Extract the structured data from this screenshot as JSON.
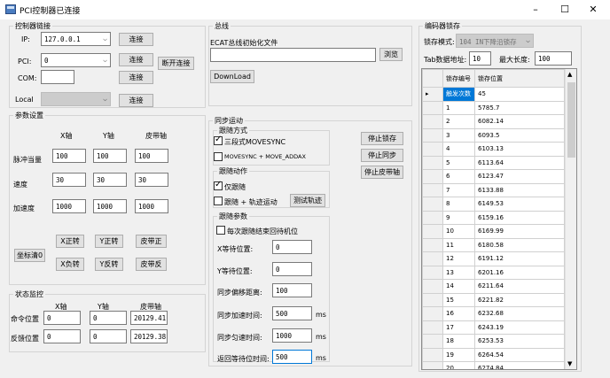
{
  "window": {
    "title": "PCI控制器已连接",
    "minimize": "–",
    "maximize": "☐",
    "close": "✕"
  },
  "controller": {
    "legend": "控制器链接",
    "ip_label": "IP:",
    "ip_value": "127.0.0.1",
    "pci_label": "PCI:",
    "pci_value": "0",
    "com_label": "COM:",
    "com_value": "",
    "local_label": "Local",
    "local_value": "",
    "connect_label": "连接",
    "disconnect_label": "断开连接"
  },
  "params": {
    "legend": "参数设置",
    "col_x": "X轴",
    "col_y": "Y轴",
    "col_belt": "皮带轴",
    "rows": [
      {
        "label": "脉冲当量",
        "x": "100",
        "y": "100",
        "belt": "100"
      },
      {
        "label": "速度",
        "x": "30",
        "y": "30",
        "belt": "30"
      },
      {
        "label": "加速度",
        "x": "1000",
        "y": "1000",
        "belt": "1000"
      }
    ],
    "zero_label": "坐标清0",
    "x_fwd": "X正转",
    "y_fwd": "Y正转",
    "belt_fwd": "皮带正",
    "x_rev": "X负转",
    "y_rev": "Y反转",
    "belt_rev": "皮带反"
  },
  "status": {
    "legend": "状态监控",
    "col_x": "X轴",
    "col_y": "Y轴",
    "col_belt": "皮带轴",
    "cmd_label": "命令位置",
    "cmd_x": "0",
    "cmd_y": "0",
    "cmd_belt": "20129.41",
    "fb_label": "反馈位置",
    "fb_x": "0",
    "fb_y": "0",
    "fb_belt": "20129.38"
  },
  "bus": {
    "legend": "总线",
    "init_label": "ECAT总线初始化文件",
    "file_value": "",
    "browse_label": "浏览",
    "download_label": "DownLoad"
  },
  "sync": {
    "legend": "同步运动",
    "mode_legend": "跟随方式",
    "mode1_label": "三段式MOVESYNC",
    "mode1_checked": true,
    "mode2_label": "MOVESYNC + MOVE_ADDAX",
    "mode2_checked": false,
    "stop_latch": "停止锁存",
    "stop_sync": "停止同步",
    "stop_belt": "停止皮带轴",
    "action_legend": "跟随动作",
    "action1_label": "仅跟随",
    "action1_checked": true,
    "action2_label": "跟随 + 轨迹运动",
    "action2_checked": false,
    "test_label": "测试轨迹",
    "params_legend": "跟随参数",
    "reset_label": "每次跟随结束回待机位",
    "reset_checked": false,
    "x_wait_label": "X等待位置:",
    "x_wait_value": "0",
    "y_wait_label": "Y等待位置:",
    "y_wait_value": "0",
    "offset_label": "同步偏移距离:",
    "offset_value": "100",
    "acc_label": "同步加速时间:",
    "acc_value": "500",
    "acc_unit": "ms",
    "const_label": "同步匀速时间:",
    "const_value": "1000",
    "const_unit": "ms",
    "ret_label": "返回等待位时间:",
    "ret_value": "500",
    "ret_unit": "ms"
  },
  "encoder": {
    "legend": "编码器锁存",
    "mode_label": "锁存模式:",
    "mode_value": "104 IN下降沿锁存",
    "tab_label": "Tab数据地址:",
    "tab_value": "10",
    "max_label": "最大长度:",
    "max_value": "100",
    "col_index": "锁存编号",
    "col_pos": "锁存位置",
    "rows": [
      {
        "idx": "触发次数",
        "pos": "45"
      },
      {
        "idx": "1",
        "pos": "5785.7"
      },
      {
        "idx": "2",
        "pos": "6082.14"
      },
      {
        "idx": "3",
        "pos": "6093.5"
      },
      {
        "idx": "4",
        "pos": "6103.13"
      },
      {
        "idx": "5",
        "pos": "6113.64"
      },
      {
        "idx": "6",
        "pos": "6123.47"
      },
      {
        "idx": "7",
        "pos": "6133.88"
      },
      {
        "idx": "8",
        "pos": "6149.53"
      },
      {
        "idx": "9",
        "pos": "6159.16"
      },
      {
        "idx": "10",
        "pos": "6169.99"
      },
      {
        "idx": "11",
        "pos": "6180.58"
      },
      {
        "idx": "12",
        "pos": "6191.12"
      },
      {
        "idx": "13",
        "pos": "6201.16"
      },
      {
        "idx": "14",
        "pos": "6211.64"
      },
      {
        "idx": "15",
        "pos": "6221.82"
      },
      {
        "idx": "16",
        "pos": "6232.68"
      },
      {
        "idx": "17",
        "pos": "6243.19"
      },
      {
        "idx": "18",
        "pos": "6253.53"
      },
      {
        "idx": "19",
        "pos": "6264.54"
      },
      {
        "idx": "20",
        "pos": "6274.84"
      }
    ]
  }
}
